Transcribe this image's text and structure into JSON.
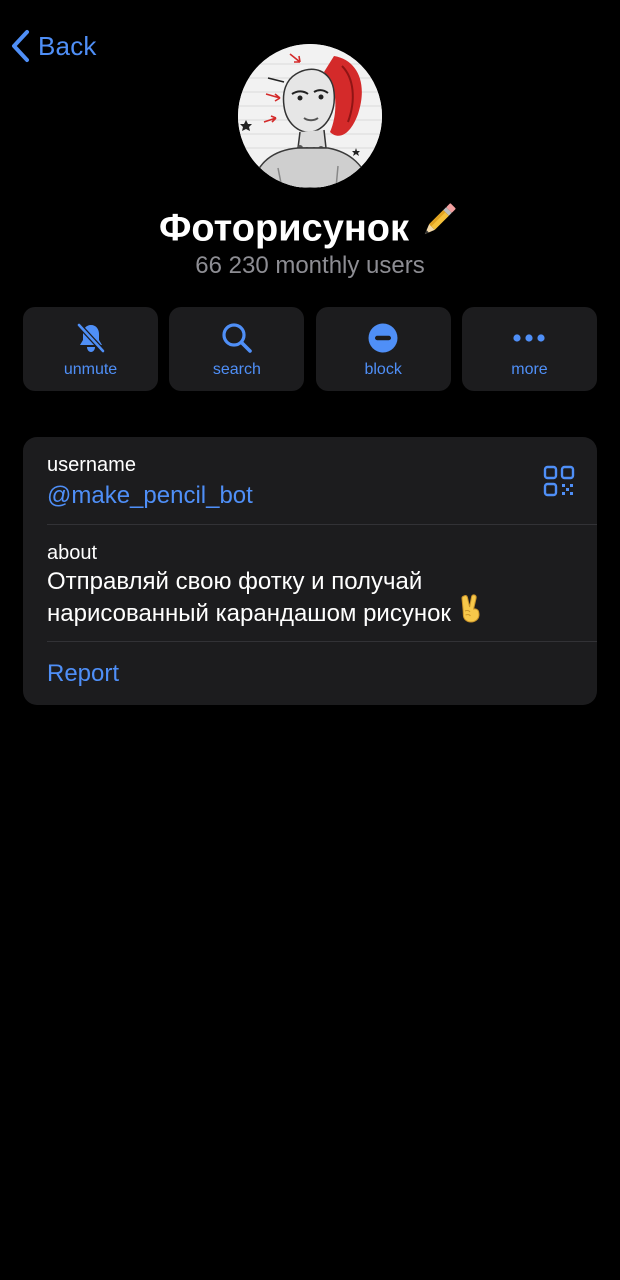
{
  "nav": {
    "back_label": "Back"
  },
  "profile": {
    "name": "Фоторисунок",
    "name_emoji": "pencil-emoji",
    "subtitle": "66 230 monthly users"
  },
  "actions": [
    {
      "label": "unmute",
      "icon": "bell-slash-icon"
    },
    {
      "label": "search",
      "icon": "search-icon"
    },
    {
      "label": "block",
      "icon": "block-icon"
    },
    {
      "label": "more",
      "icon": "more-icon"
    }
  ],
  "info": {
    "username_label": "username",
    "username_value": "@make_pencil_bot",
    "about_label": "about",
    "about_line1": "Отправляй свою фотку и получай",
    "about_line2": "нарисованный карандашом рисунок",
    "about_emoji": "victory-hand-emoji",
    "report_label": "Report"
  },
  "colors": {
    "background": "#000000",
    "card": "#1c1c1e",
    "accent": "#4f8ff7",
    "secondary_text": "#8d8d93",
    "divider": "#323236"
  }
}
